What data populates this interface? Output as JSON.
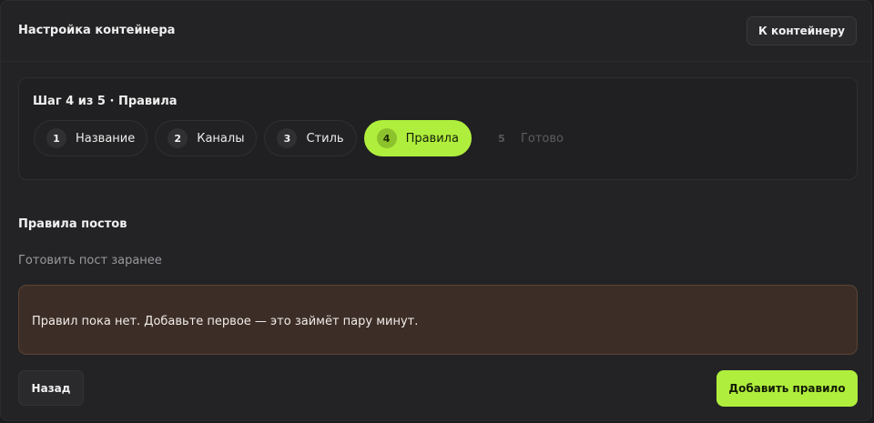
{
  "header": {
    "title": "Настройка контейнера",
    "back_to_container_label": "К контейнеру"
  },
  "stepper": {
    "heading": "Шаг 4 из 5 · Правила",
    "steps": [
      {
        "number": "1",
        "label": "Название",
        "state": "done"
      },
      {
        "number": "2",
        "label": "Каналы",
        "state": "done"
      },
      {
        "number": "3",
        "label": "Стиль",
        "state": "done"
      },
      {
        "number": "4",
        "label": "Правила",
        "state": "active"
      },
      {
        "number": "5",
        "label": "Готово",
        "state": "disabled"
      }
    ]
  },
  "section": {
    "title": "Правила постов",
    "subtitle": "Готовить пост заранее",
    "empty_message": "Правил пока нет. Добавьте первое — это займёт пару минут."
  },
  "footer": {
    "back_label": "Назад",
    "add_rule_label": "Добавить правило"
  },
  "colors": {
    "accent": "#b0ee3d",
    "empty_state_bg": "#3c2e27",
    "background": "#232325"
  }
}
